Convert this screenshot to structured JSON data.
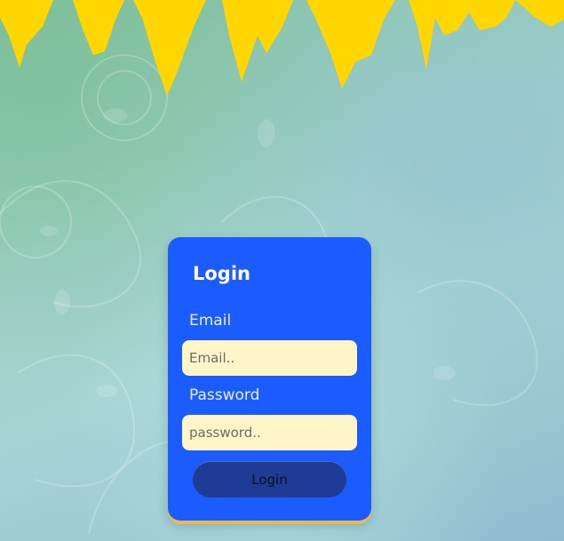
{
  "colors": {
    "banner": "#ffd600",
    "card": "#1a5cff",
    "input_bg": "#fff5c8",
    "button": "#1f3b94"
  },
  "login_form": {
    "title": "Login",
    "email_label": "Email",
    "email_placeholder": "Email..",
    "password_label": "Password",
    "password_placeholder": "password..",
    "submit_label": "Login"
  }
}
